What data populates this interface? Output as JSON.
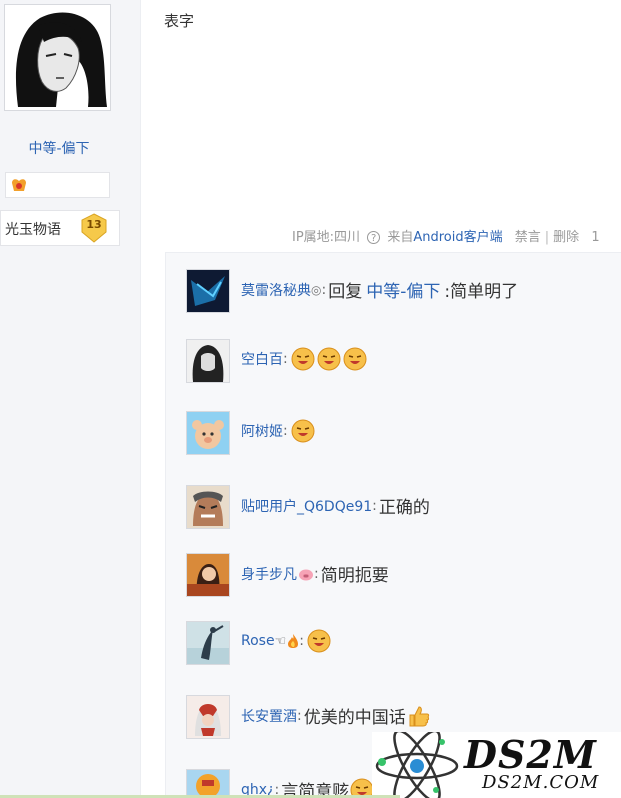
{
  "author": {
    "username": "中等-偏下",
    "level_name": "光玉物语",
    "level": "13"
  },
  "post": {
    "text": "表字",
    "ip_location": "IP属地:四川",
    "help_glyph": "?",
    "client_prefix": "来自",
    "client": "Android客户端",
    "mute": "禁言",
    "separator": "|",
    "delete": "删除",
    "overflow": "1"
  },
  "replies": [
    {
      "user": "莫雷洛秘典",
      "badge": "◎",
      "colon": ":",
      "prefix": "回复",
      "link": "中等-偏下",
      "text": ":简单明了",
      "emojis": 0
    },
    {
      "user": "空白百",
      "colon": ":",
      "text": "",
      "emojis": 3
    },
    {
      "user": "阿树姬",
      "colon": ":",
      "text": "",
      "emojis": 1
    },
    {
      "user": "贴吧用户_Q6DQe91",
      "colon": ":",
      "text": "正确的",
      "emojis": 0
    },
    {
      "user": "身手步凡",
      "colon": ":",
      "text": "简明扼要",
      "emojis": 0
    },
    {
      "user": "Rose",
      "badge": "☜",
      "colon": ":",
      "text": "",
      "emojis": 1
    },
    {
      "user": "长安置酒",
      "colon": ":",
      "text": "优美的中国话",
      "emojis": 0
    },
    {
      "user": "qhx¿",
      "colon": ":",
      "text": "言简意赅",
      "emojis": 1
    }
  ],
  "watermark": {
    "big": "DS2M",
    "small": "DS2M.COM"
  },
  "colors": {
    "link": "#2d64b3",
    "sidebar_bg": "#f4f5f8",
    "reply_bg": "#f7f8fa",
    "muted": "#999999"
  },
  "icons": [
    "help-icon",
    "pig-icon",
    "fire-icon",
    "thumbs-up-icon",
    "grin-emoji"
  ]
}
